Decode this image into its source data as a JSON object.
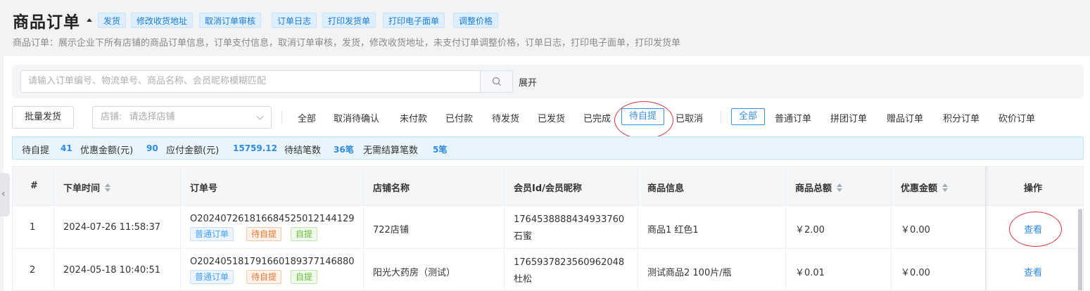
{
  "header": {
    "title": "商品订单",
    "buttons": [
      "发货",
      "修改收货地址",
      "取消订单审核",
      "订单日志",
      "打印发货单",
      "打印电子面单",
      "调整价格"
    ],
    "description": "商品订单：展示企业下所有店铺的商品订单信息，订单支付信息，取消订单审核，发货，修改收货地址，未支付订单调整价格，订单日志，打印电子面单，打印发货单"
  },
  "search": {
    "placeholder": "请输入订单编号、物流单号、商品名称、会员昵称模糊匹配",
    "expand_label": "展开"
  },
  "toolbar": {
    "batch_ship_label": "批量发货",
    "store_label": "店铺:",
    "store_placeholder": "请选择店铺"
  },
  "status_tabs": {
    "items": [
      "全部",
      "取消待确认",
      "未付款",
      "已付款",
      "待发货",
      "已发货",
      "已完成",
      "待自提",
      "已取消"
    ],
    "selected": "待自提"
  },
  "type_tabs": {
    "items": [
      "全部",
      "普通订单",
      "拼团订单",
      "赠品订单",
      "积分订单",
      "砍价订单"
    ],
    "selected": "全部"
  },
  "summary": {
    "pending_pickup_label": "待自提",
    "pending_pickup_value": "41",
    "discount_label": "优惠金额(元)",
    "discount_value": "90",
    "payable_label": "应付金额(元)",
    "payable_value": "15759.12",
    "pending_settle_label": "待结笔数",
    "pending_settle_value": "36笔",
    "no_settle_label": "无需结算笔数",
    "no_settle_value": "5笔"
  },
  "table": {
    "columns": [
      "#",
      "下单时间",
      "订单号",
      "店铺名称",
      "会员Id/会员昵称",
      "商品信息",
      "商品总额",
      "优惠金额",
      "操作"
    ],
    "rows": [
      {
        "index": "1",
        "order_time": "2024-07-26 11:58:37",
        "order_no": "O20240726181668452501214412​9",
        "tags": [
          "普通订单",
          "待自提",
          "自提"
        ],
        "store": "722店铺",
        "member_id": "1764538888434933760",
        "member_nick": "石蜜",
        "product": "商品1 红色1",
        "total": "￥2.00",
        "discount": "￥0.00",
        "action": "查看"
      },
      {
        "index": "2",
        "order_time": "2024-05-18 10:40:51",
        "order_no": "O20240518179166018937714688​0",
        "tags": [
          "普通订单",
          "待自提",
          "自提"
        ],
        "store": "阳光大药房（测试）",
        "member_id": "1765937823560962048",
        "member_nick": "杜松",
        "product": "测试商品2 100片/瓶",
        "total": "￥0.01",
        "discount": "￥0.00",
        "action": "查看"
      }
    ]
  }
}
